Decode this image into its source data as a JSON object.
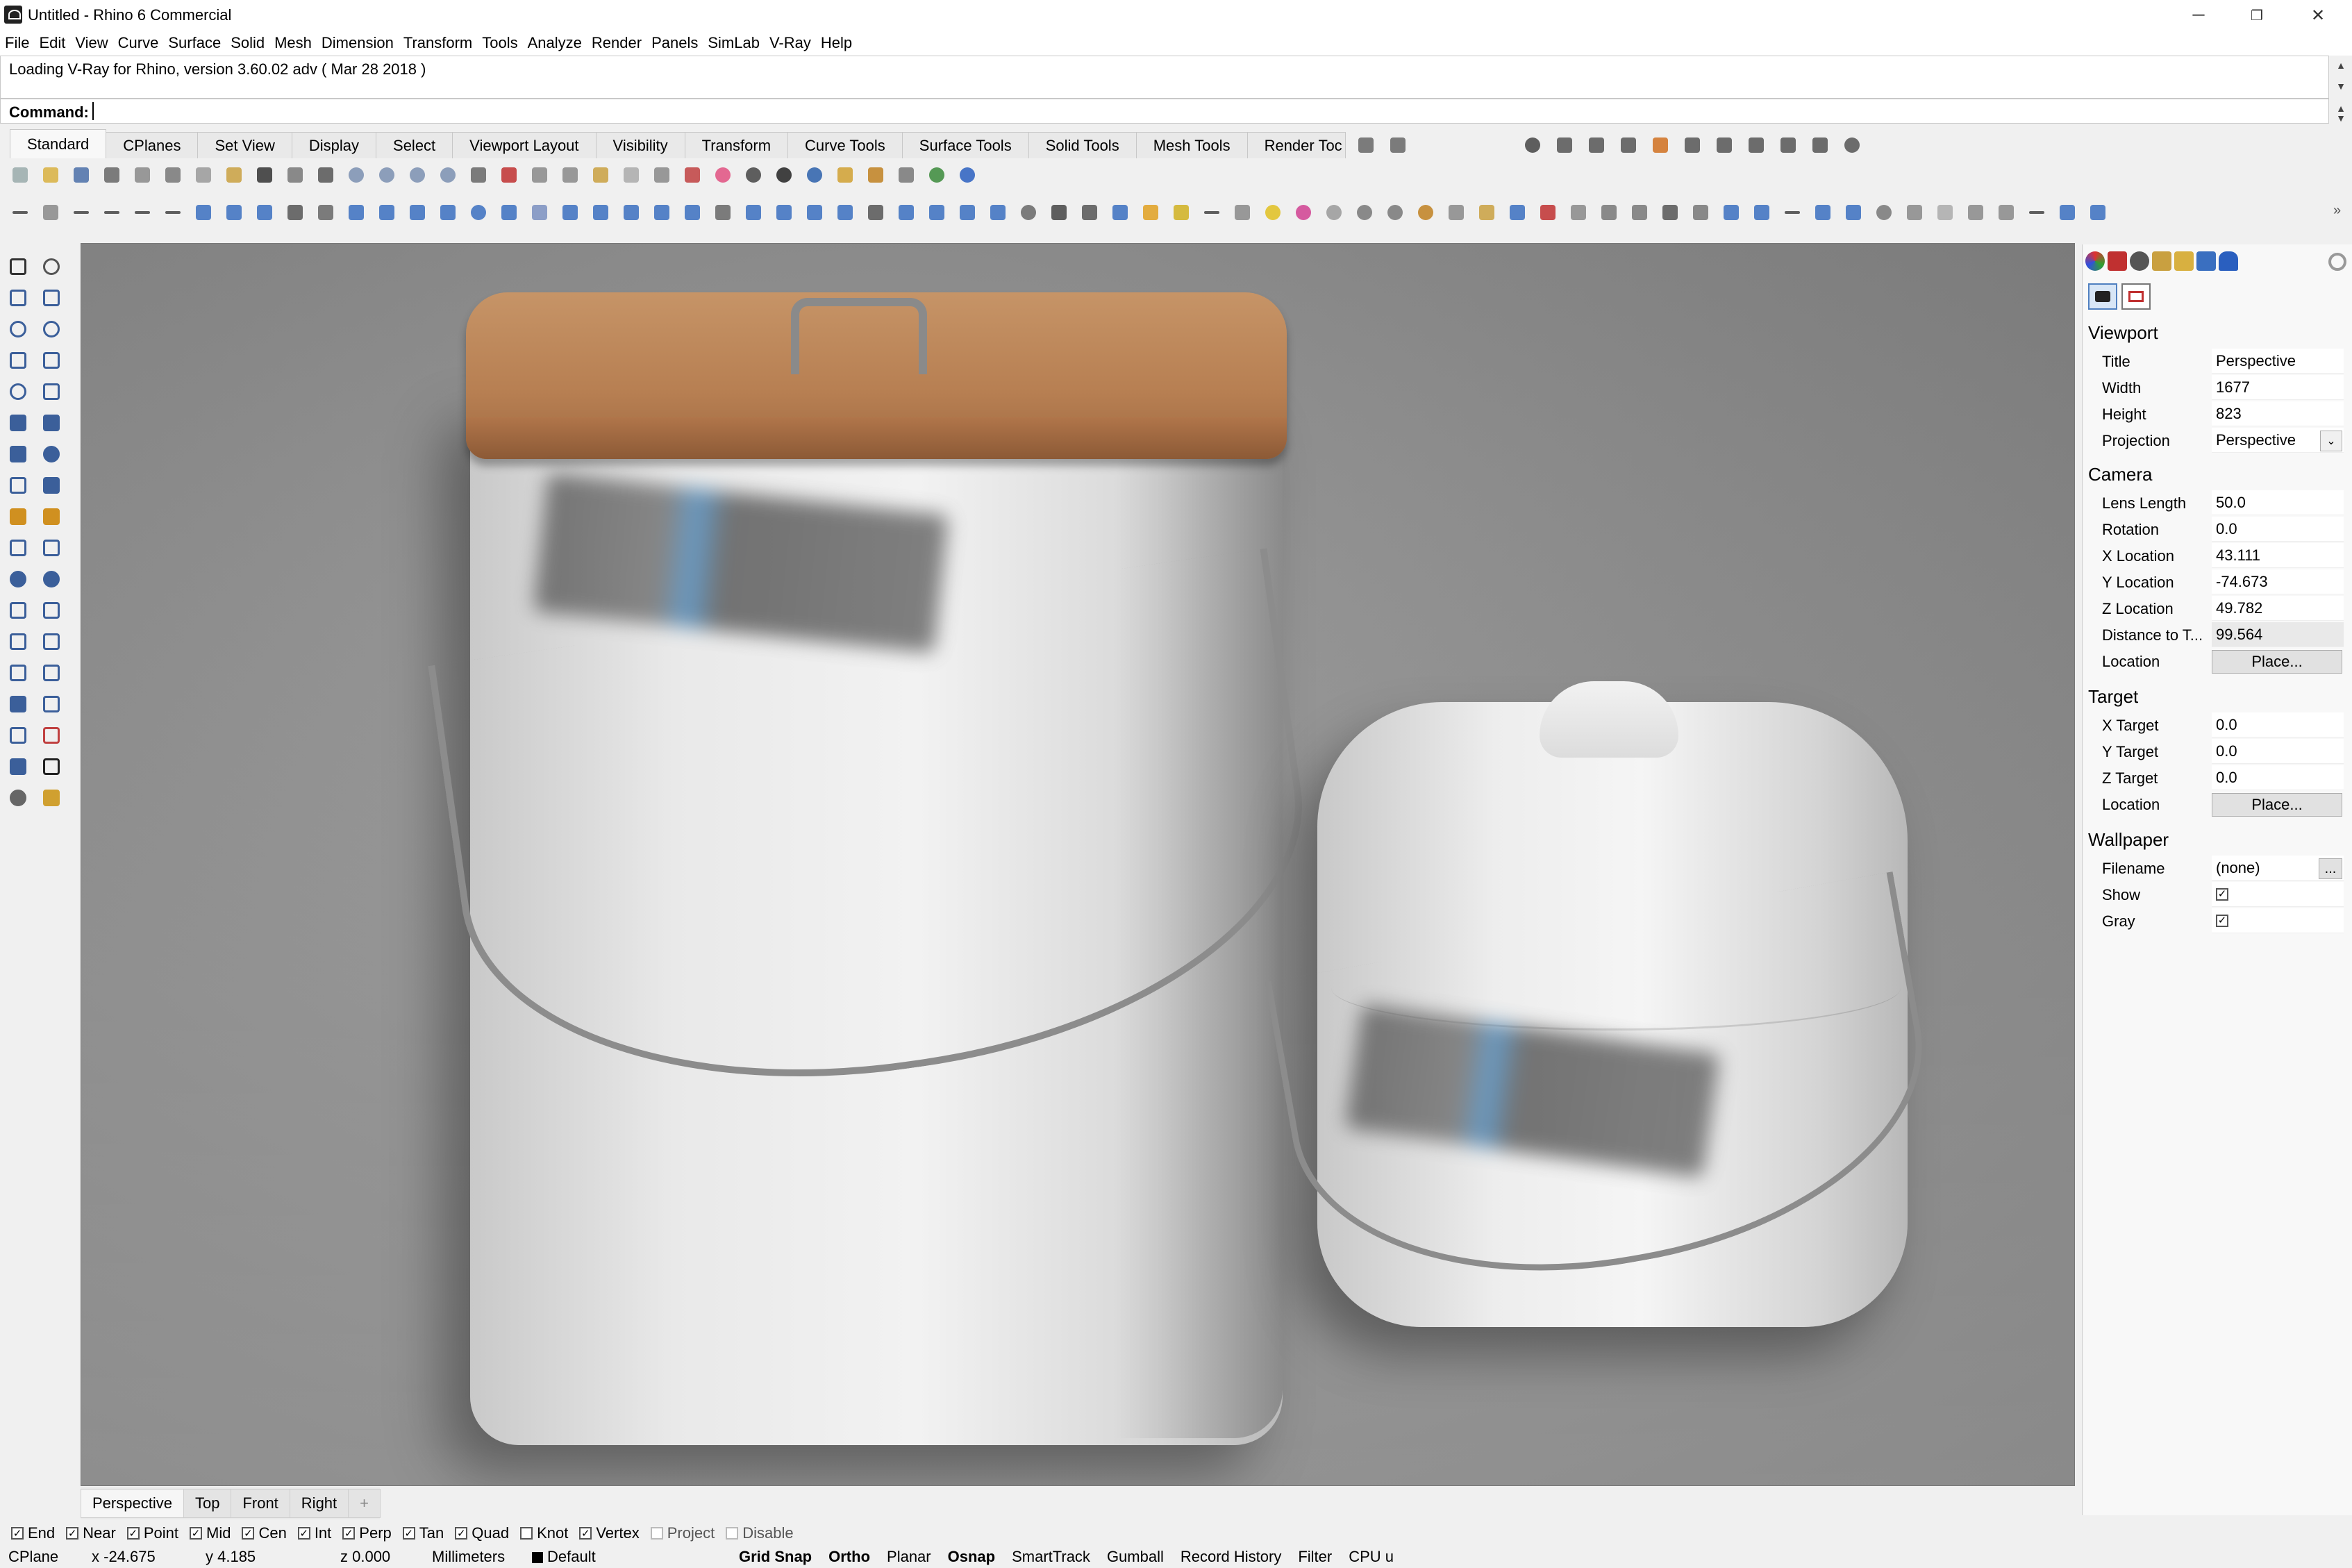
{
  "window": {
    "title": "Untitled - Rhino 6 Commercial",
    "minimize": "─",
    "restore": "❐",
    "close": "✕"
  },
  "menu": [
    "File",
    "Edit",
    "View",
    "Curve",
    "Surface",
    "Solid",
    "Mesh",
    "Dimension",
    "Transform",
    "Tools",
    "Analyze",
    "Render",
    "Panels",
    "SimLab",
    "V-Ray",
    "Help"
  ],
  "command": {
    "history": "Loading V-Ray for Rhino, version 3.60.02 adv ( Mar 28 2018 )",
    "label": "Command:",
    "value": ""
  },
  "toolbar_tabs": [
    "Standard",
    "CPlanes",
    "Set View",
    "Display",
    "Select",
    "Viewport Layout",
    "Visibility",
    "Transform",
    "Curve Tools",
    "Surface Tools",
    "Solid Tools",
    "Mesh Tools",
    "Render Toc"
  ],
  "active_tab": "Standard",
  "viewport_tabs": [
    "Perspective",
    "Top",
    "Front",
    "Right"
  ],
  "viewport_add": "+",
  "active_viewport": "Perspective",
  "osnaps": [
    {
      "label": "End",
      "checked": true
    },
    {
      "label": "Near",
      "checked": true
    },
    {
      "label": "Point",
      "checked": true
    },
    {
      "label": "Mid",
      "checked": true
    },
    {
      "label": "Cen",
      "checked": true
    },
    {
      "label": "Int",
      "checked": true
    },
    {
      "label": "Perp",
      "checked": true
    },
    {
      "label": "Tan",
      "checked": true
    },
    {
      "label": "Quad",
      "checked": true
    },
    {
      "label": "Knot",
      "checked": false
    },
    {
      "label": "Vertex",
      "checked": true
    },
    {
      "label": "Project",
      "checked": false,
      "disabled": true
    },
    {
      "label": "Disable",
      "checked": false,
      "disabled": true
    }
  ],
  "status": {
    "cplane": "CPlane",
    "x": "x -24.675",
    "y": "y 4.185",
    "z": "z 0.000",
    "units": "Millimeters",
    "layer": "Default",
    "grid_snap": "Grid Snap",
    "ortho": "Ortho",
    "planar": "Planar",
    "osnap": "Osnap",
    "smarttrack": "SmartTrack",
    "gumball": "Gumball",
    "record_history": "Record History",
    "filter": "Filter",
    "cpu": "CPU u"
  },
  "panel": {
    "check_mark": "✓",
    "viewport": {
      "heading": "Viewport",
      "title_label": "Title",
      "title": "Perspective",
      "width_label": "Width",
      "width": "1677",
      "height_label": "Height",
      "height": "823",
      "projection_label": "Projection",
      "projection": "Perspective",
      "dropdown": "⌄"
    },
    "camera": {
      "heading": "Camera",
      "lens_label": "Lens Length",
      "lens": "50.0",
      "rotation_label": "Rotation",
      "rotation": "0.0",
      "xloc_label": "X Location",
      "xloc": "43.111",
      "yloc_label": "Y Location",
      "yloc": "-74.673",
      "zloc_label": "Z Location",
      "zloc": "49.782",
      "dist_label": "Distance to T...",
      "dist": "99.564",
      "location_label": "Location",
      "location_btn": "Place..."
    },
    "target": {
      "heading": "Target",
      "x_label": "X Target",
      "x": "0.0",
      "y_label": "Y Target",
      "y": "0.0",
      "z_label": "Z Target",
      "z": "0.0",
      "location_label": "Location",
      "location_btn": "Place..."
    },
    "wallpaper": {
      "heading": "Wallpaper",
      "filename_label": "Filename",
      "filename": "(none)",
      "browse": "...",
      "show_label": "Show",
      "show": true,
      "gray_label": "Gray",
      "gray": true
    }
  }
}
